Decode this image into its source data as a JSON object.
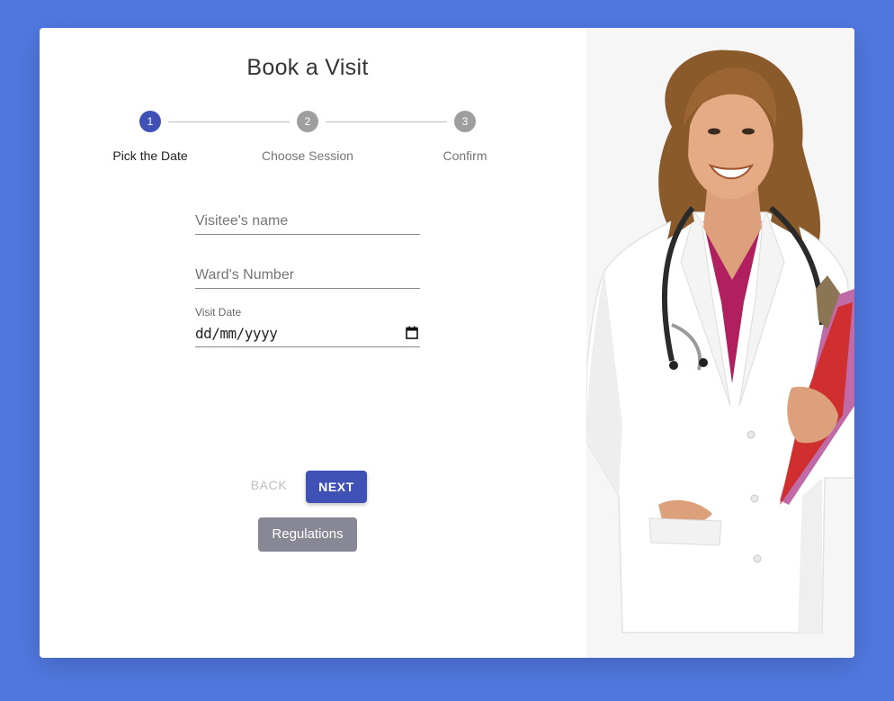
{
  "form": {
    "title": "Book a Visit",
    "steps": [
      {
        "number": "1",
        "label": "Pick the Date",
        "state": "active"
      },
      {
        "number": "2",
        "label": "Choose Session",
        "state": "inactive"
      },
      {
        "number": "3",
        "label": "Confirm",
        "state": "inactive"
      }
    ],
    "fields": {
      "visitee_name_placeholder": "Visitee's name",
      "ward_number_placeholder": "Ward's Number",
      "visit_date_label": "Visit Date",
      "visit_date_value": "dd/mm/yyyy"
    },
    "buttons": {
      "back": "BACK",
      "next": "NEXT",
      "regulations": "Regulations"
    }
  },
  "colors": {
    "background": "#5078e0",
    "primary": "#3f51b5",
    "inactive_step": "#9e9e9e",
    "regulations_button": "#878796"
  },
  "illustration": {
    "subject": "smiling doctor in white coat with stethoscope holding folders"
  }
}
